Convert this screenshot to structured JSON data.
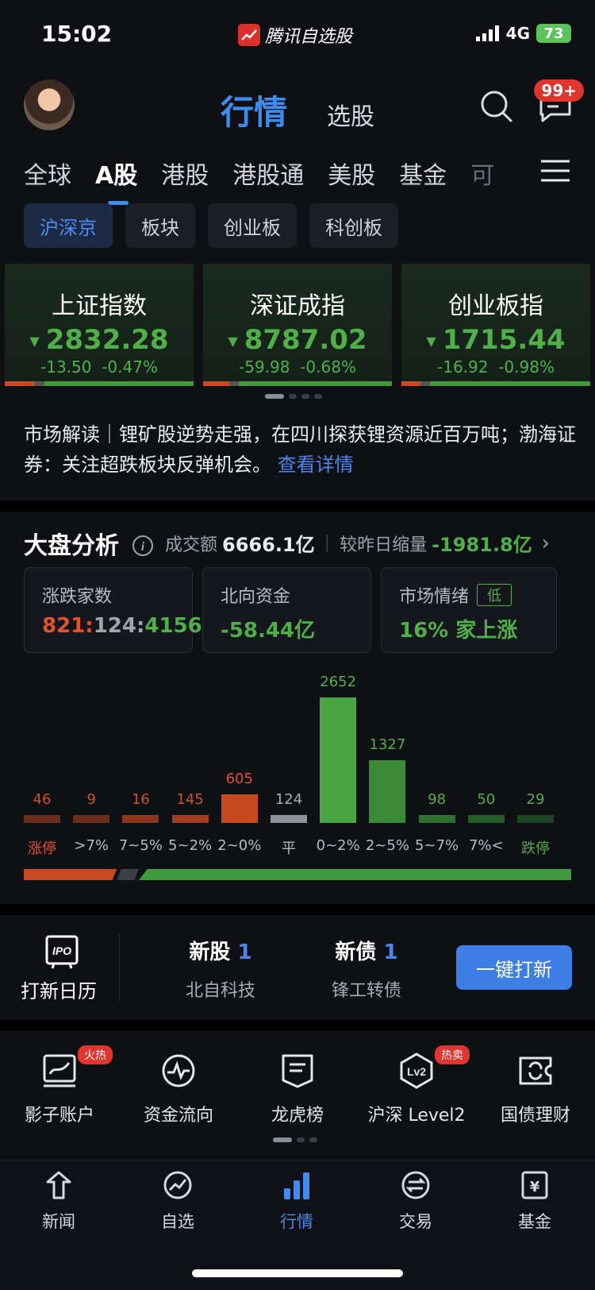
{
  "status": {
    "time": "15:02",
    "app_name": "腾讯自选股",
    "network": "4G",
    "battery": "73"
  },
  "header": {
    "title_active": "行情",
    "title_other": "选股",
    "badge": "99+"
  },
  "tabs": [
    "全球",
    "A股",
    "港股",
    "港股通",
    "美股",
    "基金",
    "可"
  ],
  "subtabs": [
    "沪深京",
    "板块",
    "创业板",
    "科创板"
  ],
  "indices": [
    {
      "name": "上证指数",
      "value": "2832.28",
      "change": "-13.50",
      "pct": "-0.47%"
    },
    {
      "name": "深证成指",
      "value": "8787.02",
      "change": "-59.98",
      "pct": "-0.68%"
    },
    {
      "name": "创业板指",
      "value": "1715.44",
      "change": "-16.92",
      "pct": "-0.98%"
    }
  ],
  "news": {
    "text": "市场解读｜锂矿股逆势走强，在四川探获锂资源近百万吨；渤海证券：关注超跌板块反弹机会。",
    "link": "查看详情"
  },
  "market": {
    "title": "大盘分析",
    "turnover_label": "成交额",
    "turnover": "6666.1亿",
    "diff_label": "较昨日缩量",
    "diff": "-1981.8亿",
    "updown_label": "涨跌家数",
    "up": "821",
    "flat": "124",
    "down": "4156",
    "north_label": "北向资金",
    "north": "-58.44亿",
    "mood_label": "市场情绪",
    "mood_tag": "低",
    "mood_value": "16%",
    "mood_suffix": "家上涨"
  },
  "chart_data": {
    "type": "bar",
    "categories": [
      "涨停",
      ">7%",
      "7~5%",
      "5~2%",
      "2~0%",
      "平",
      "0~2%",
      "2~5%",
      "5~7%",
      "7%<",
      "跌停"
    ],
    "values": [
      46,
      9,
      16,
      145,
      605,
      124,
      2652,
      1327,
      98,
      50,
      29
    ]
  },
  "ipo": {
    "calendar": "打新日历",
    "stock_label": "新股",
    "stock_count": "1",
    "stock_name": "北自科技",
    "bond_label": "新债",
    "bond_count": "1",
    "bond_name": "锋工转债",
    "button": "一键打新"
  },
  "tools": [
    {
      "label": "影子账户",
      "badge": "火热"
    },
    {
      "label": "资金流向",
      "badge": ""
    },
    {
      "label": "龙虎榜",
      "badge": ""
    },
    {
      "label": "沪深 Level2",
      "badge": "热卖"
    },
    {
      "label": "国债理财",
      "badge": ""
    }
  ],
  "nav": [
    "新闻",
    "自选",
    "行情",
    "交易",
    "基金"
  ],
  "colors": {
    "accent": "#3d8cf0",
    "up": "#e0532f",
    "down": "#4fb04a"
  }
}
